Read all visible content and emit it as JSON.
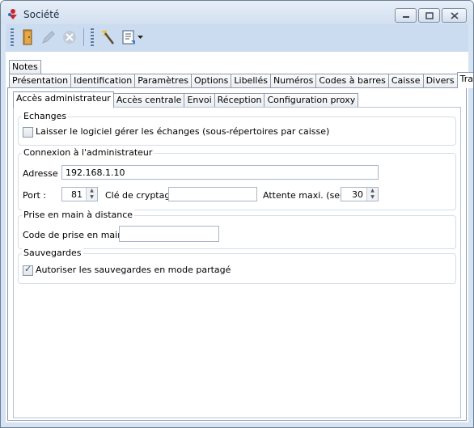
{
  "window": {
    "title": "Société",
    "title_color": "#1a2a40",
    "frame_color": "#d6e3f2"
  },
  "toolbar": {
    "buttons": [
      "door-exit-icon",
      "pencil-edit-icon",
      "cancel-icon",
      "wand-icon",
      "document-list-icon"
    ]
  },
  "tabs_top": [
    "Notes"
  ],
  "tabs_main": [
    "Présentation",
    "Identification",
    "Paramètres",
    "Options",
    "Libellés",
    "Numéros",
    "Codes à barres",
    "Caisse",
    "Divers",
    "Transferts"
  ],
  "active_main_tab": "Transferts",
  "subtabs": [
    "Accès administrateur",
    "Accès centrale",
    "Envoi",
    "Réception",
    "Configuration proxy"
  ],
  "active_subtab": "Accès administrateur",
  "groups": {
    "echanges": {
      "title": "Echanges",
      "checkbox_label": "Laisser le logiciel gérer les échanges (sous-répertoires par caisse)",
      "checked": false
    },
    "admin": {
      "title": "Connexion à l'administrateur",
      "address_label": "Adresse :",
      "address_value": "192.168.1.10",
      "port_label": "Port :",
      "port_value": "81",
      "key_label": "Clé de cryptage :",
      "key_value": "",
      "timeout_label": "Attente maxi. (sec) :",
      "timeout_value": "30"
    },
    "remote": {
      "title": "Prise en main à distance",
      "code_label": "Code de prise en main :",
      "code_value": ""
    },
    "backups": {
      "title": "Sauvegardes",
      "checkbox_label": "Autoriser les sauvegardes en mode partagé",
      "checked": true
    }
  }
}
